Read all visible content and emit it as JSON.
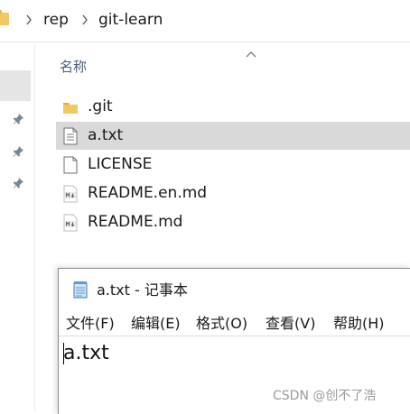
{
  "explorer": {
    "breadcrumb": [
      "rep",
      "git-learn"
    ],
    "column_header": "名称",
    "files": [
      {
        "name": ".git",
        "icon": "folder-icon",
        "selected": false
      },
      {
        "name": "a.txt",
        "icon": "text-file-icon",
        "selected": true
      },
      {
        "name": "LICENSE",
        "icon": "blank-file-icon",
        "selected": false
      },
      {
        "name": "README.en.md",
        "icon": "markdown-file-icon",
        "selected": false
      },
      {
        "name": "README.md",
        "icon": "markdown-file-icon",
        "selected": false
      }
    ],
    "selection_color": "#d9d9d9",
    "folder_color": "#f4c860"
  },
  "notepad": {
    "title": "a.txt - 记事本",
    "menu": [
      "文件(F)",
      "编辑(E)",
      "格式(O)",
      "查看(V)",
      "帮助(H)"
    ],
    "content": "a.txt"
  },
  "watermark": "CSDN @创不了浩"
}
